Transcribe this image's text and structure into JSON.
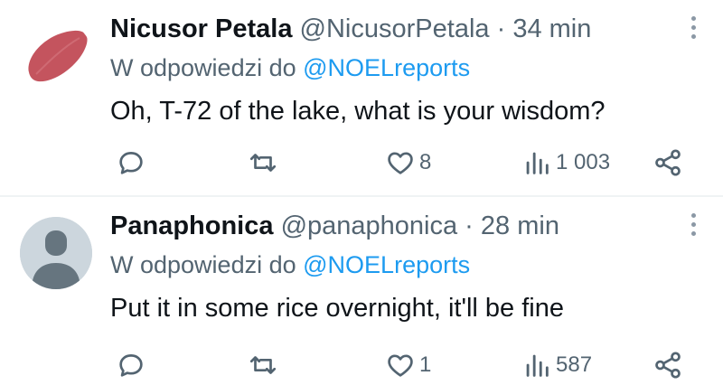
{
  "tweets": [
    {
      "name": "Nicusor Petala",
      "handle": "@NicusorPetala",
      "separator": "·",
      "time": "34 min",
      "reply_prefix": "W odpowiedzi do",
      "reply_to": "@NOELreports",
      "text": "Oh, T-72 of the lake, what is your wisdom?",
      "likes": "8",
      "views": "1 003",
      "avatar_color": "#c4545e"
    },
    {
      "name": "Panaphonica",
      "handle": "@panaphonica",
      "separator": "·",
      "time": "28 min",
      "reply_prefix": "W odpowiedzi do",
      "reply_to": "@NOELreports",
      "text": "Put it in some rice overnight, it'll be fine",
      "likes": "1",
      "views": "587",
      "avatar_color": "#ccd6dd"
    }
  ],
  "icons": {
    "reply": "reply-icon",
    "retweet": "retweet-icon",
    "like": "heart-icon",
    "views": "views-icon",
    "share": "share-icon",
    "more": "more-vertical-icon"
  },
  "colors": {
    "text": "#0f1419",
    "secondary": "#536471",
    "link": "#1d9bf0",
    "divider": "#eff3f4"
  }
}
